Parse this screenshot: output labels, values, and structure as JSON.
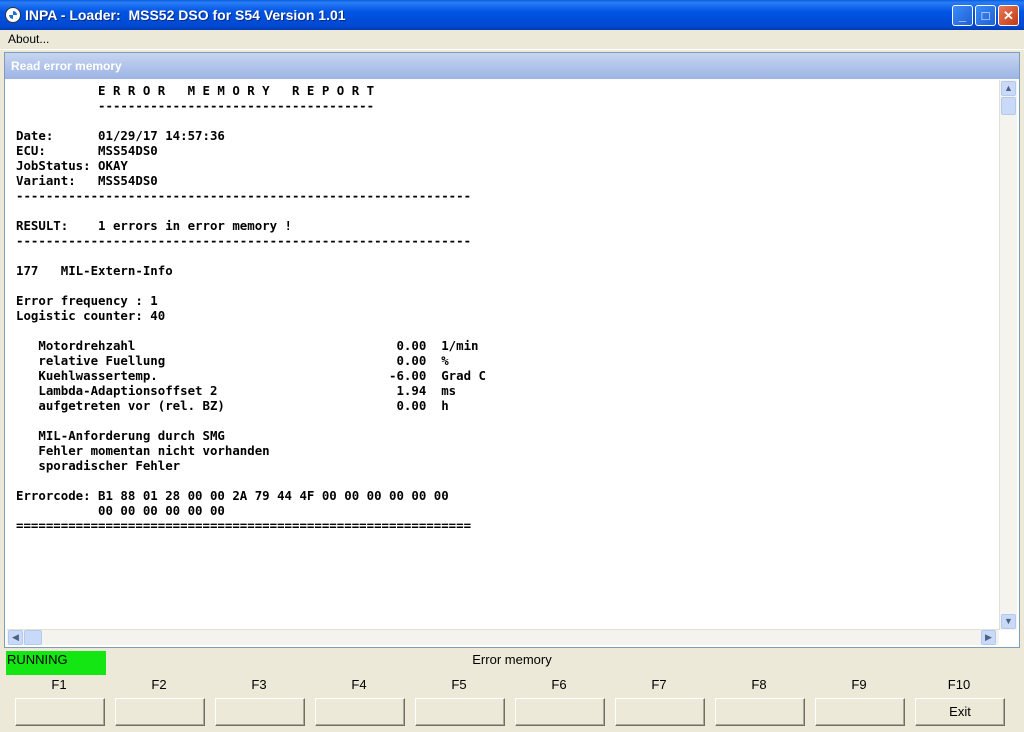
{
  "window": {
    "title": "INPA - Loader:  MSS52 DSO for S54 Version 1.01",
    "minimize_glyph": "_",
    "maximize_glyph": "□",
    "close_glyph": "✕"
  },
  "menu": {
    "items": [
      {
        "label": "About..."
      }
    ]
  },
  "panel": {
    "title": "Read error memory",
    "report_text": "           E R R O R   M E M O R Y   R E P O R T\n           -------------------------------------\n\nDate:      01/29/17 14:57:36\nECU:       MSS54DS0\nJobStatus: OKAY\nVariant:   MSS54DS0\n-------------------------------------------------------------\n\nRESULT:    1 errors in error memory !\n-------------------------------------------------------------\n\n177   MIL-Extern-Info\n\nError frequency : 1\nLogistic counter: 40\n\n   Motordrehzahl                                   0.00  1/min\n   relative Fuellung                               0.00  %\n   Kuehlwassertemp.                               -6.00  Grad C\n   Lambda-Adaptionsoffset 2                        1.94  ms\n   aufgetreten vor (rel. BZ)                       0.00  h\n\n   MIL-Anforderung durch SMG\n   Fehler momentan nicht vorhanden\n   sporadischer Fehler\n\nErrorcode: B1 88 01 28 00 00 2A 79 44 4F 00 00 00 00 00 00\n           00 00 00 00 00 00\n============================================================="
  },
  "scrollbars": {
    "up_icon": "up-arrow-icon",
    "down_icon": "down-arrow-icon",
    "left_icon": "left-arrow-icon",
    "right_icon": "right-arrow-icon",
    "up_glyph": "▲",
    "down_glyph": "▼",
    "left_glyph": "◀",
    "right_glyph": "▶"
  },
  "status": {
    "state": "RUNNING",
    "state_color": "#13e613",
    "screen_title": "Error memory"
  },
  "function_keys": [
    {
      "key": "F1",
      "label": ""
    },
    {
      "key": "F2",
      "label": ""
    },
    {
      "key": "F3",
      "label": ""
    },
    {
      "key": "F4",
      "label": ""
    },
    {
      "key": "F5",
      "label": ""
    },
    {
      "key": "F6",
      "label": ""
    },
    {
      "key": "F7",
      "label": ""
    },
    {
      "key": "F8",
      "label": ""
    },
    {
      "key": "F9",
      "label": ""
    },
    {
      "key": "F10",
      "label": "Exit"
    }
  ]
}
